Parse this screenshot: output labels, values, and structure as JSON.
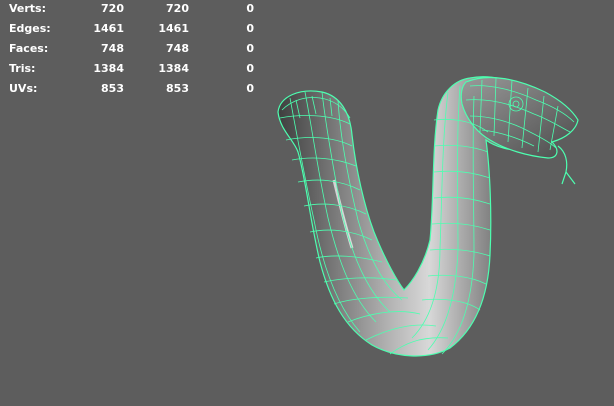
{
  "hud": {
    "rows": [
      {
        "label": "Verts:",
        "total": "720",
        "selected": "720",
        "component": "0"
      },
      {
        "label": "Edges:",
        "total": "1461",
        "selected": "1461",
        "component": "0"
      },
      {
        "label": "Faces:",
        "total": "748",
        "selected": "748",
        "component": "0"
      },
      {
        "label": "Tris:",
        "total": "1384",
        "selected": "1384",
        "component": "0"
      },
      {
        "label": "UVs:",
        "total": "853",
        "selected": "853",
        "component": "0"
      }
    ]
  },
  "colors": {
    "viewport_background": "#5d5d5d",
    "wireframe": "#4dffb0",
    "mesh_shade_light": "#c8c8c8",
    "mesh_shade_dark": "#3a3a3a",
    "hud_text": "#ffffff"
  }
}
